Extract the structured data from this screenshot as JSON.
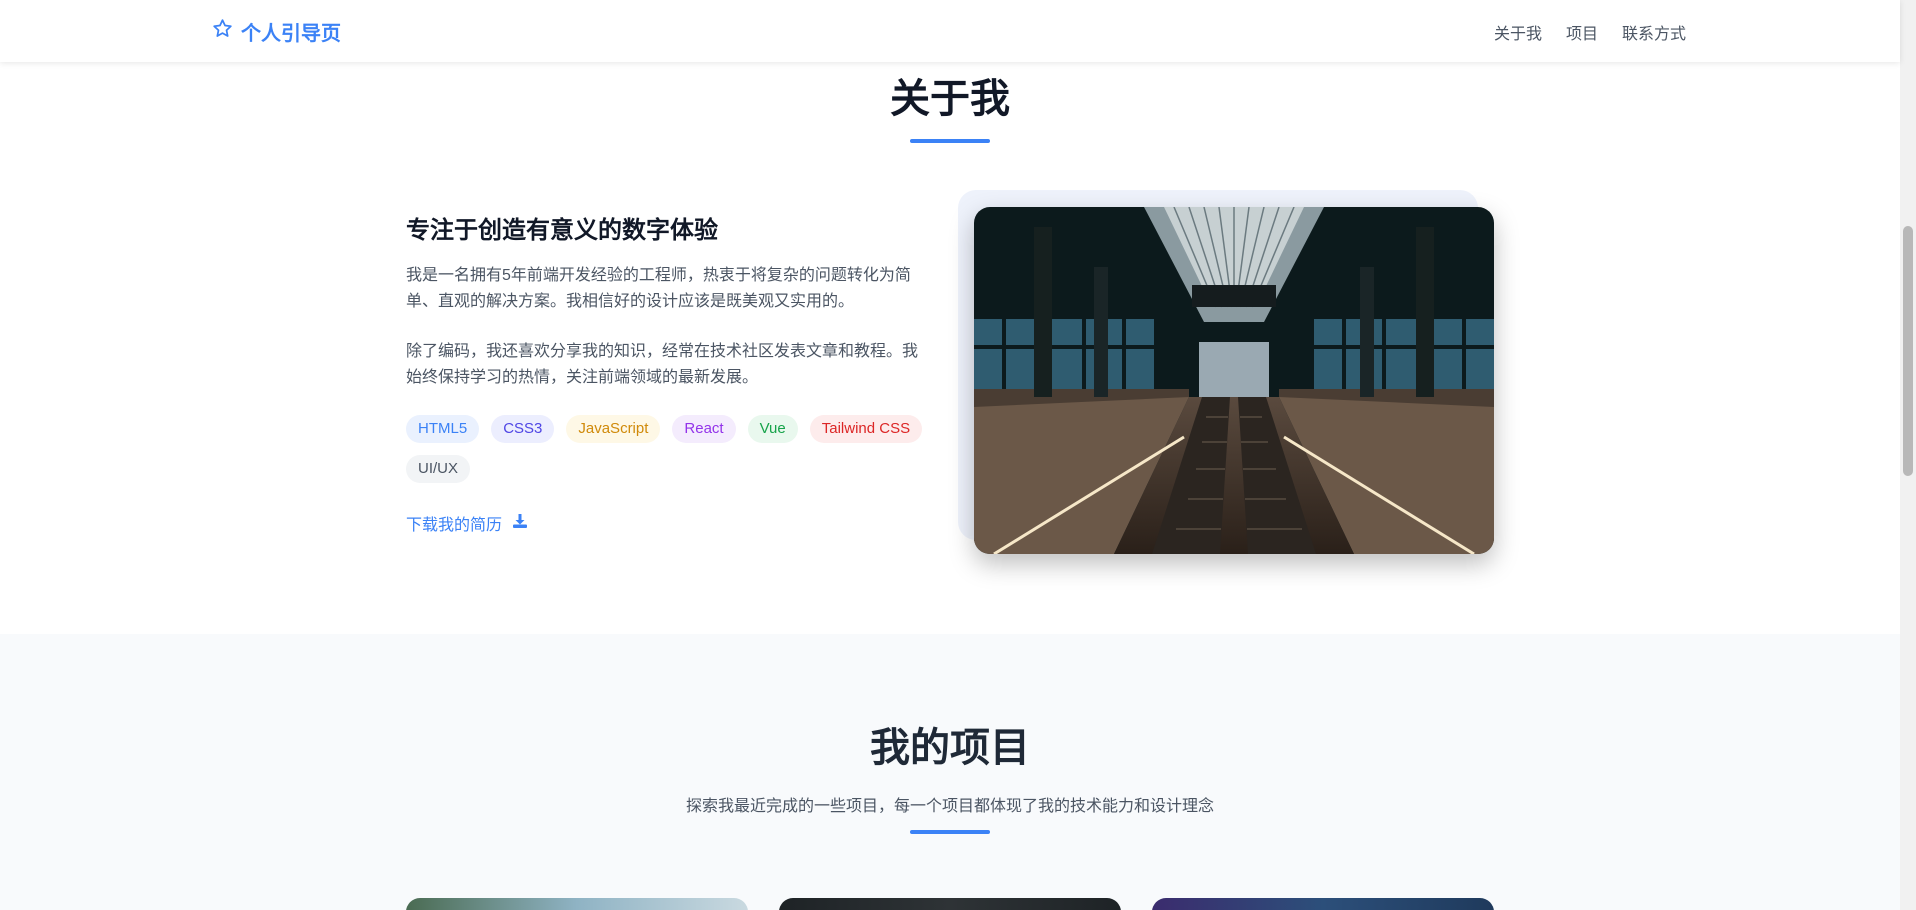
{
  "header": {
    "brand": "个人引导页",
    "nav": [
      "关于我",
      "项目",
      "联系方式"
    ]
  },
  "about": {
    "title": "关于我",
    "subtitle": "专注于创造有意义的数字体验",
    "paragraphs": [
      "我是一名拥有5年前端开发经验的工程师，热衷于将复杂的问题转化为简单、直观的解决方案。我相信好的设计应该是既美观又实用的。",
      "除了编码，我还喜欢分享我的知识，经常在技术社区发表文章和教程。我始终保持学习的热情，关注前端领域的最新发展。"
    ],
    "tags": [
      {
        "label": "HTML5",
        "color": "#3b82f6",
        "bg": "#eaf1fe"
      },
      {
        "label": "CSS3",
        "color": "#4f46e5",
        "bg": "#eceefe"
      },
      {
        "label": "JavaScript",
        "color": "#d08a0a",
        "bg": "#fef8e6"
      },
      {
        "label": "React",
        "color": "#9333ea",
        "bg": "#f4ecfd"
      },
      {
        "label": "Vue",
        "color": "#16a34a",
        "bg": "#e9f8ee"
      },
      {
        "label": "Tailwind CSS",
        "color": "#dc2626",
        "bg": "#fdecec"
      },
      {
        "label": "UI/UX",
        "color": "#4b5563",
        "bg": "#f2f4f6"
      }
    ],
    "resume_label": "下载我的简历"
  },
  "projects": {
    "title": "我的项目",
    "description": "探索我最近完成的一些项目，每一个项目都体现了我的技术能力和设计理念"
  },
  "colors": {
    "accent": "#3b82f6",
    "heading": "#111827",
    "body_text": "#4b5563"
  }
}
